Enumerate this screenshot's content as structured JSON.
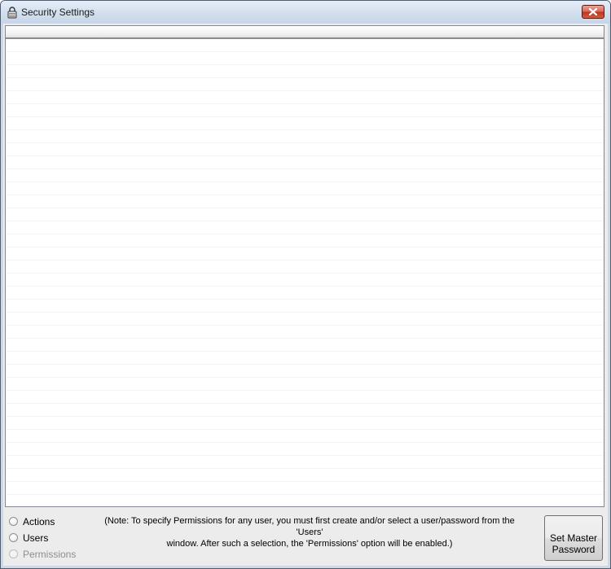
{
  "window": {
    "title": "Security Settings"
  },
  "options": [
    {
      "label": "Actions",
      "disabled": false
    },
    {
      "label": "Users",
      "disabled": false
    },
    {
      "label": "Permissions",
      "disabled": true
    }
  ],
  "note": {
    "line1": "(Note: To specify Permissions for any user, you must first create and/or select a user/password from the 'Users'",
    "line2": "window.  After such a selection, the 'Permissions' option will be enabled.)"
  },
  "master_button": {
    "line1": "Set Master",
    "line2": "Password"
  }
}
